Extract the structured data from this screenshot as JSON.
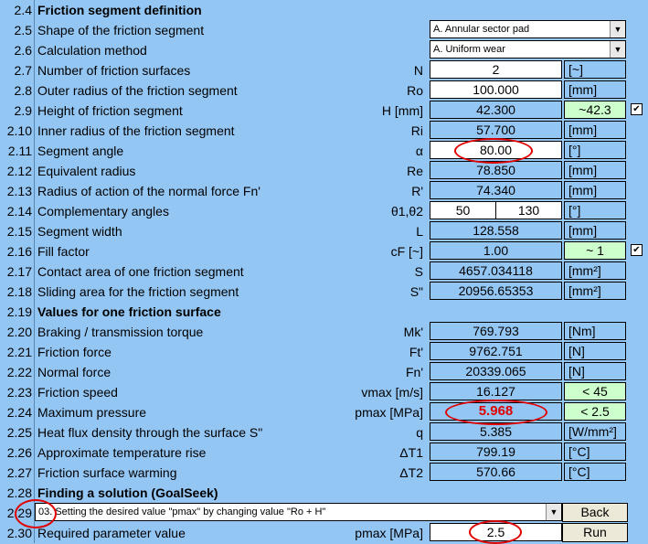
{
  "rows": [
    {
      "num": "2.4",
      "name": "Friction segment definition"
    },
    {
      "num": "2.5",
      "name": "Shape of the friction segment",
      "value": "A. Annular sector pad"
    },
    {
      "num": "2.6",
      "name": "Calculation method",
      "value": "A. Uniform wear"
    },
    {
      "num": "2.7",
      "name": "Number of friction surfaces",
      "sym": "N",
      "value": "2",
      "unit": "[~]"
    },
    {
      "num": "2.8",
      "name": "Outer radius of the friction segment",
      "sym": "Ro",
      "value": "100.000",
      "unit": "[mm]"
    },
    {
      "num": "2.9",
      "name": "Height of friction segment",
      "sym": "H [mm]",
      "value": "42.300",
      "hint": "~42.3",
      "check": "✔"
    },
    {
      "num": "2.10",
      "name": "Inner radius of the friction segment",
      "sym": "Ri",
      "value": "57.700",
      "unit": "[mm]"
    },
    {
      "num": "2.11",
      "name": "Segment angle",
      "sym": "α",
      "value": "80.00",
      "unit": "[°]"
    },
    {
      "num": "2.12",
      "name": "Equivalent radius",
      "sym": "Re",
      "value": "78.850",
      "unit": "[mm]"
    },
    {
      "num": "2.13",
      "name": "Radius of action of the normal force Fn'",
      "sym": "R'",
      "value": "74.340",
      "unit": "[mm]"
    },
    {
      "num": "2.14",
      "name": "Complementary angles",
      "sym": "θ1,θ2",
      "value": "50",
      "value2": "130",
      "unit": "[°]"
    },
    {
      "num": "2.15",
      "name": "Segment width",
      "sym": "L",
      "value": "128.558",
      "unit": "[mm]"
    },
    {
      "num": "2.16",
      "name": "Fill factor",
      "sym": "cF [~]",
      "value": "1.00",
      "hint": "~ 1",
      "check": "✔"
    },
    {
      "num": "2.17",
      "name": "Contact area of one friction segment",
      "sym": "S",
      "value": "4657.034118",
      "unit": "[mm²]"
    },
    {
      "num": "2.18",
      "name": "Sliding area for the friction segment",
      "sym": "S\"",
      "value": "20956.65353",
      "unit": "[mm²]"
    },
    {
      "num": "2.19",
      "name": "Values for one friction surface"
    },
    {
      "num": "2.20",
      "name": "Braking / transmission torque",
      "sym": "Mk'",
      "value": "769.793",
      "unit": "[Nm]"
    },
    {
      "num": "2.21",
      "name": "Friction force",
      "sym": "Ft'",
      "value": "9762.751",
      "unit": "[N]"
    },
    {
      "num": "2.22",
      "name": "Normal force",
      "sym": "Fn'",
      "value": "20339.065",
      "unit": "[N]"
    },
    {
      "num": "2.23",
      "name": "Friction speed",
      "sym": "vmax [m/s]",
      "value": "16.127",
      "hint": "< 45"
    },
    {
      "num": "2.24",
      "name": "Maximum pressure",
      "sym": "pmax [MPa]",
      "value": "5.968",
      "hint": "< 2.5"
    },
    {
      "num": "2.25",
      "name": "Heat flux density through the surface S\"",
      "sym": "q",
      "value": "5.385",
      "unit": "[W/mm²]"
    },
    {
      "num": "2.26",
      "name": "Approximate temperature rise",
      "sym": "ΔT1",
      "value": "799.19",
      "unit": "[°C]"
    },
    {
      "num": "2.27",
      "name": "Friction surface warming",
      "sym": "ΔT2",
      "value": "570.66",
      "unit": "[°C]"
    },
    {
      "num": "2.28",
      "name": "Finding a solution (GoalSeek)"
    },
    {
      "num": "2.29",
      "value": "03. Setting the desired value \"pmax\" by changing value \"Ro + H\"",
      "button": "Back"
    },
    {
      "num": "2.30",
      "name": "Required parameter value",
      "sym": "pmax [MPa]",
      "value": "2.5",
      "button": "Run"
    }
  ],
  "icons": {
    "dropdown": "chevron-down-icon",
    "check": "checkbox-checked-icon"
  },
  "colors": {
    "background": "#94c6f4",
    "input": "#ffffff",
    "hint": "#ccffcc",
    "highlight": "#e00000"
  }
}
